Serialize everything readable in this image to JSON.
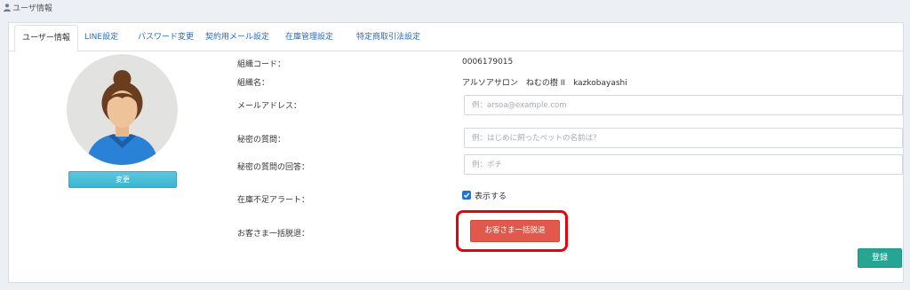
{
  "header": {
    "title": "ユーザ情報",
    "icon": "user-icon"
  },
  "tabs": [
    {
      "label": "ユーザー情報",
      "active": true
    },
    {
      "label": "LINE設定"
    },
    {
      "label": "パスワード変更"
    },
    {
      "label": "契約用メール設定"
    },
    {
      "label": "在庫管理設定"
    },
    {
      "label": "特定商取引法設定"
    }
  ],
  "profile": {
    "avatar_icon": "avatar-icon",
    "change_button": "変更"
  },
  "fields": {
    "org_code": {
      "label": "組織コード：",
      "value": "0006179015"
    },
    "org_name": {
      "label": "組織名：",
      "value": "アルソアサロン　ねむの樹 II　kazkobayashi"
    },
    "email": {
      "label": "メールアドレス：",
      "value": "",
      "placeholder": "例：arsoa@example.com"
    },
    "secret_question": {
      "label": "秘密の質問：",
      "value": "",
      "placeholder": "例：はじめに飼ったペットの名前は？"
    },
    "secret_answer": {
      "label": "秘密の質問の回答：",
      "value": "",
      "placeholder": "例：ポチ"
    },
    "stock_alert": {
      "label": "在庫不足アラート：",
      "checkbox_label": "表示する",
      "checked": true
    },
    "bulk_withdraw": {
      "label": "お客さま一括脱退：",
      "button": "お客さま一括脱退"
    }
  },
  "actions": {
    "register": "登録"
  },
  "colors": {
    "tab_link": "#2a6bc2",
    "change_button": "#3ab5d2",
    "withdraw_button": "#e0594c",
    "register_button": "#25a592",
    "highlight": "#e8000b",
    "checkbox": "#1e73d8"
  }
}
